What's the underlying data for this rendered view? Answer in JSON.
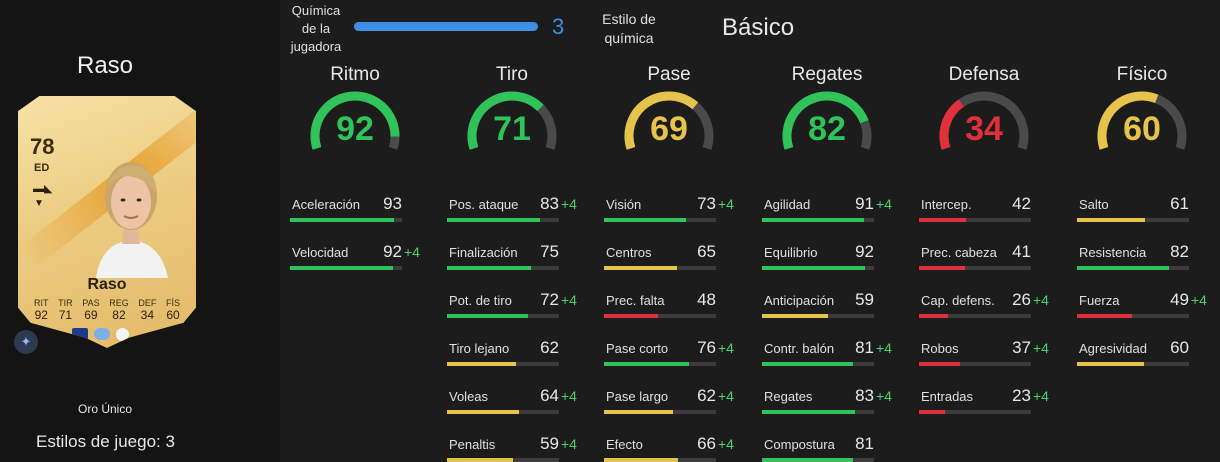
{
  "player": {
    "name": "Raso",
    "card": {
      "rating": "78",
      "position": "ED",
      "name": "Raso",
      "stats": [
        {
          "label": "RIT",
          "value": "92"
        },
        {
          "label": "TIR",
          "value": "71"
        },
        {
          "label": "PAS",
          "value": "69"
        },
        {
          "label": "REG",
          "value": "82"
        },
        {
          "label": "DEF",
          "value": "34"
        },
        {
          "label": "FÍS",
          "value": "60"
        }
      ]
    },
    "rarity": "Oro Único",
    "playstyles": "Estilos de juego: 3"
  },
  "chemistry": {
    "label": "Química de la jugadora",
    "value": "3",
    "max": 3,
    "style_label": "Estilo de química",
    "style_value": "Básico"
  },
  "colors": {
    "green": "#2fc35a",
    "yellow": "#e6c34a",
    "red": "#e0303a",
    "blue": "#3d8fe6",
    "boost": "#4fcf6a"
  },
  "columns": [
    {
      "title": "Ritmo",
      "value": "92",
      "color": "#2fc35a",
      "level": 92,
      "stats": [
        {
          "name": "Aceleración",
          "value": "93",
          "boost": "",
          "level": 93,
          "color": "#2fc35a"
        },
        {
          "name": "Velocidad",
          "value": "92",
          "boost": "+4",
          "level": 92,
          "color": "#2fc35a"
        }
      ]
    },
    {
      "title": "Tiro",
      "value": "71",
      "color": "#2fc35a",
      "level": 71,
      "stats": [
        {
          "name": "Pos. ataque",
          "value": "83",
          "boost": "+4",
          "level": 83,
          "color": "#2fc35a"
        },
        {
          "name": "Finalización",
          "value": "75",
          "boost": "",
          "level": 75,
          "color": "#2fc35a"
        },
        {
          "name": "Pot. de tiro",
          "value": "72",
          "boost": "+4",
          "level": 72,
          "color": "#2fc35a"
        },
        {
          "name": "Tiro lejano",
          "value": "62",
          "boost": "",
          "level": 62,
          "color": "#e6c34a"
        },
        {
          "name": "Voleas",
          "value": "64",
          "boost": "+4",
          "level": 64,
          "color": "#e6c34a"
        },
        {
          "name": "Penaltis",
          "value": "59",
          "boost": "+4",
          "level": 59,
          "color": "#e6c34a"
        }
      ]
    },
    {
      "title": "Pase",
      "value": "69",
      "color": "#e6c34a",
      "level": 69,
      "stats": [
        {
          "name": "Visión",
          "value": "73",
          "boost": "+4",
          "level": 73,
          "color": "#2fc35a"
        },
        {
          "name": "Centros",
          "value": "65",
          "boost": "",
          "level": 65,
          "color": "#e6c34a"
        },
        {
          "name": "Prec. falta",
          "value": "48",
          "boost": "",
          "level": 48,
          "color": "#e0303a"
        },
        {
          "name": "Pase corto",
          "value": "76",
          "boost": "+4",
          "level": 76,
          "color": "#2fc35a"
        },
        {
          "name": "Pase largo",
          "value": "62",
          "boost": "+4",
          "level": 62,
          "color": "#e6c34a"
        },
        {
          "name": "Efecto",
          "value": "66",
          "boost": "+4",
          "level": 66,
          "color": "#e6c34a"
        }
      ]
    },
    {
      "title": "Regates",
      "value": "82",
      "color": "#2fc35a",
      "level": 82,
      "stats": [
        {
          "name": "Agilidad",
          "value": "91",
          "boost": "+4",
          "level": 91,
          "color": "#2fc35a"
        },
        {
          "name": "Equilibrio",
          "value": "92",
          "boost": "",
          "level": 92,
          "color": "#2fc35a"
        },
        {
          "name": "Anticipación",
          "value": "59",
          "boost": "",
          "level": 59,
          "color": "#e6c34a"
        },
        {
          "name": "Contr. balón",
          "value": "81",
          "boost": "+4",
          "level": 81,
          "color": "#2fc35a"
        },
        {
          "name": "Regates",
          "value": "83",
          "boost": "+4",
          "level": 83,
          "color": "#2fc35a"
        },
        {
          "name": "Compostura",
          "value": "81",
          "boost": "",
          "level": 81,
          "color": "#2fc35a"
        }
      ]
    },
    {
      "title": "Defensa",
      "value": "34",
      "color": "#e0303a",
      "level": 34,
      "stats": [
        {
          "name": "Intercep.",
          "value": "42",
          "boost": "",
          "level": 42,
          "color": "#e0303a"
        },
        {
          "name": "Prec. cabeza",
          "value": "41",
          "boost": "",
          "level": 41,
          "color": "#e0303a"
        },
        {
          "name": "Cap. defens.",
          "value": "26",
          "boost": "+4",
          "level": 26,
          "color": "#e0303a"
        },
        {
          "name": "Robos",
          "value": "37",
          "boost": "+4",
          "level": 37,
          "color": "#e0303a"
        },
        {
          "name": "Entradas",
          "value": "23",
          "boost": "+4",
          "level": 23,
          "color": "#e0303a"
        }
      ]
    },
    {
      "title": "Físico",
      "value": "60",
      "color": "#e6c34a",
      "level": 60,
      "stats": [
        {
          "name": "Salto",
          "value": "61",
          "boost": "",
          "level": 61,
          "color": "#e6c34a"
        },
        {
          "name": "Resistencia",
          "value": "82",
          "boost": "",
          "level": 82,
          "color": "#2fc35a"
        },
        {
          "name": "Fuerza",
          "value": "49",
          "boost": "+4",
          "level": 49,
          "color": "#e0303a"
        },
        {
          "name": "Agresividad",
          "value": "60",
          "boost": "",
          "level": 60,
          "color": "#e6c34a"
        }
      ]
    }
  ]
}
